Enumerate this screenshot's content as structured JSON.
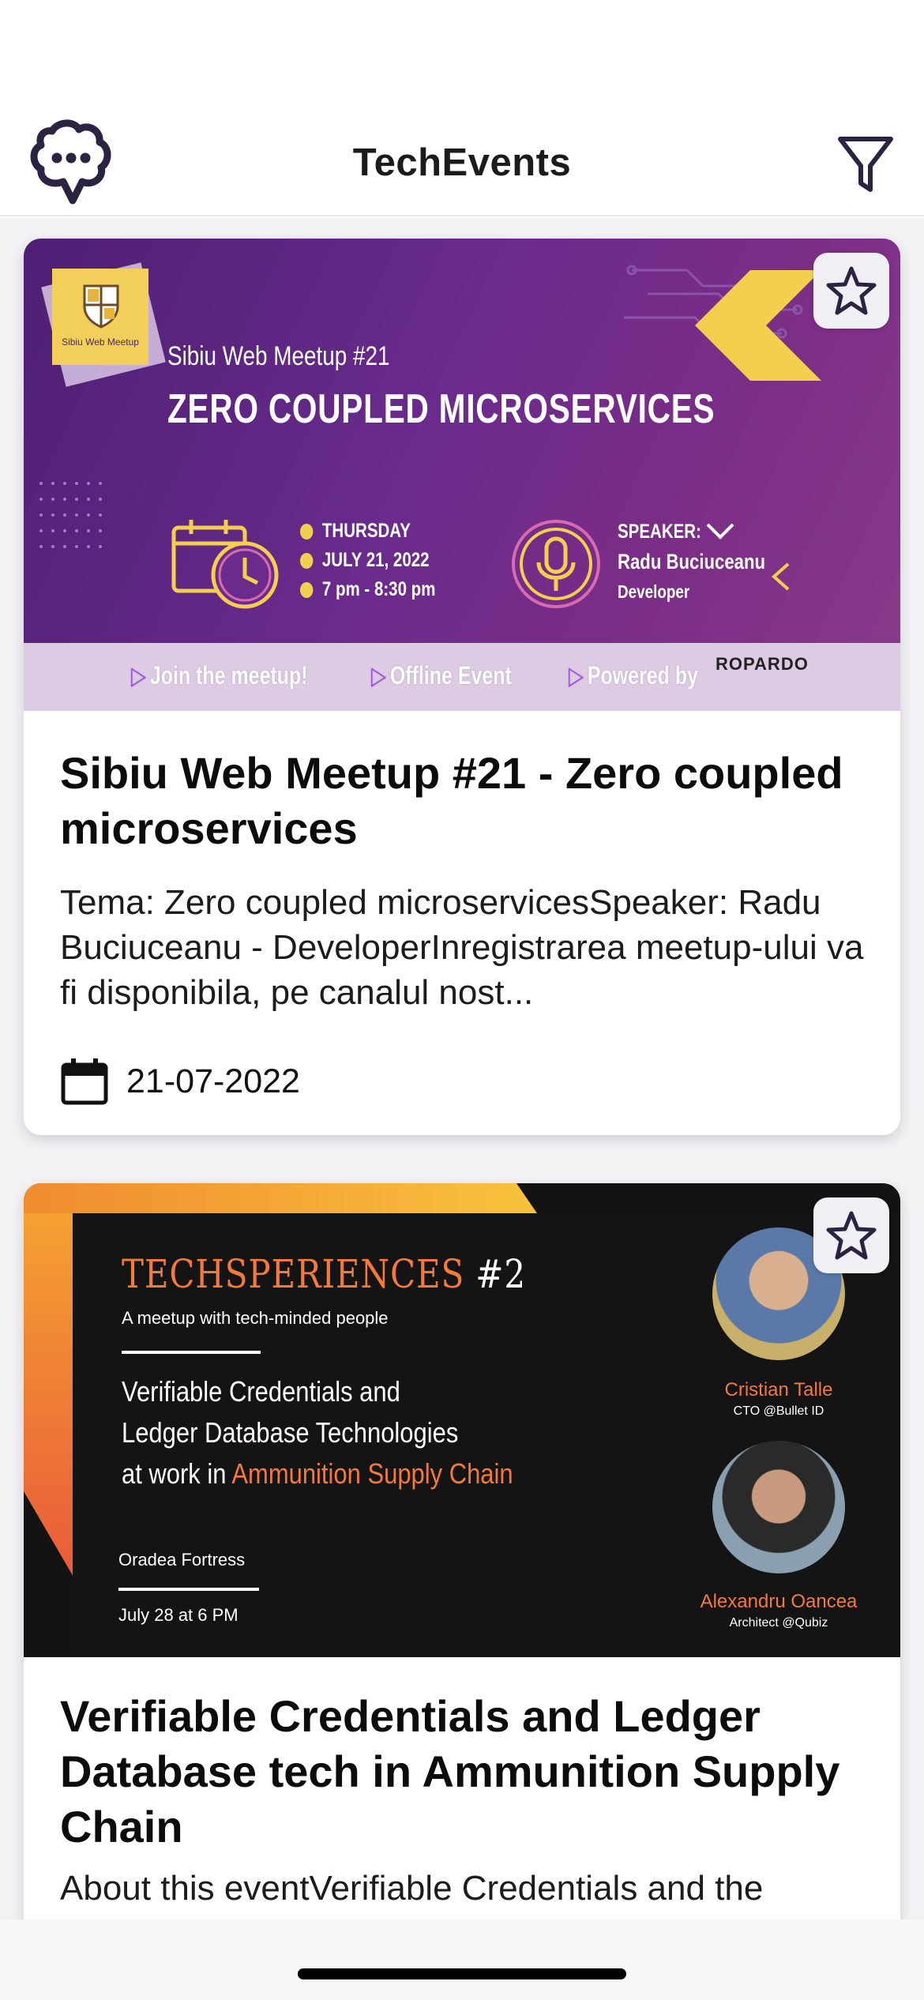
{
  "header": {
    "title": "TechEvents",
    "logo_icon": "chat-bubble-cloud-icon",
    "filter_icon": "filter-funnel-icon"
  },
  "events": [
    {
      "title": "Sibiu Web Meetup #21 - Zero coupled microservices",
      "description": "Tema: Zero coupled microservicesSpeaker: Radu Buciuceanu - DeveloperInregistrarea meetup-ului va fi disponibila, pe canalul nost...",
      "date": "21-07-2022",
      "favorite_icon": "star-outline-icon",
      "banner": {
        "logo_text": "Sibiu Web Meetup",
        "subtitle": "Sibiu Web Meetup #21",
        "headline": "ZERO COUPLED MICROSERVICES",
        "day": "THURSDAY",
        "date": "JULY 21, 2022",
        "time": "7 pm - 8:30 pm",
        "speaker_label": "SPEAKER:",
        "speaker_name": "Radu Buciuceanu",
        "speaker_role": "Developer",
        "footer_items": [
          "Join the meetup!",
          "Offline Event",
          "Powered by"
        ],
        "sponsor": "ROPARDO"
      }
    },
    {
      "title": "Verifiable Credentials and Ledger Database tech in Ammunition Supply Chain",
      "description": "About this eventVerifiable Credentials and the",
      "favorite_icon": "star-outline-icon",
      "banner": {
        "series": "TECHSPERIENCES",
        "number": "#2",
        "tagline": "A meetup with tech-minded people",
        "line1": "Verifiable Credentials and",
        "line2": "Ledger Database Technologies",
        "line3_prefix": "at work in ",
        "line3_highlight": "Ammunition Supply Chain",
        "location": "Oradea Fortress",
        "when": "July 28 at 6 PM",
        "speakers": [
          {
            "name": "Cristian Talle",
            "role": "CTO @Bullet ID"
          },
          {
            "name": "Alexandru Oancea",
            "role": "Architect @Qubiz"
          }
        ]
      }
    }
  ],
  "colors": {
    "accent_dark": "#2c2342",
    "banner1_purple": "#5a2480",
    "banner1_yellow": "#f3cf4e",
    "banner2_orange": "#f47a3a"
  }
}
